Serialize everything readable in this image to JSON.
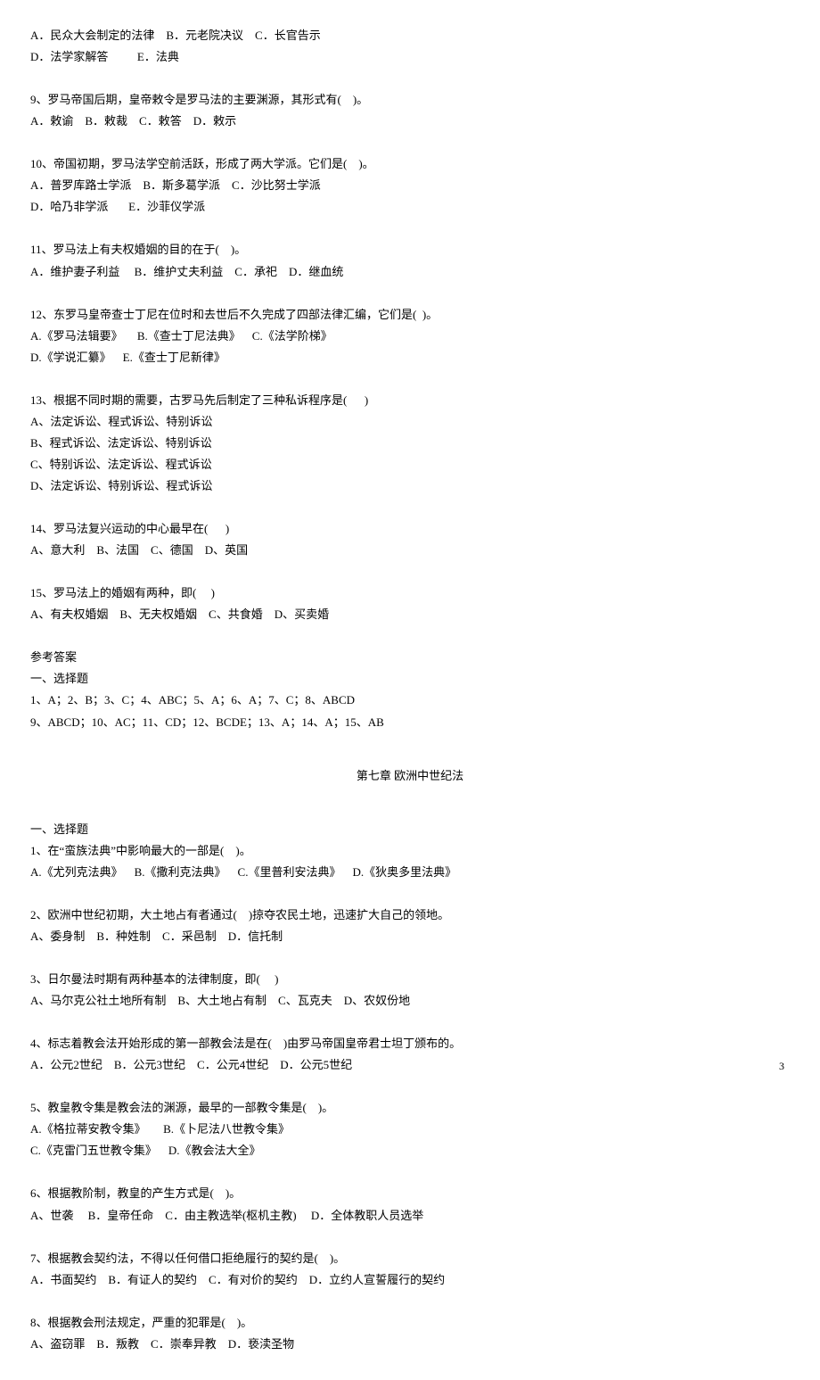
{
  "q8_opts1": "A．民众大会制定的法律    B．元老院决议    C．长官告示",
  "q8_opts2": "D．法学家解答          E．法典",
  "q9_stem": "9、罗马帝国后期，皇帝敕令是罗马法的主要渊源，其形式有(    )。",
  "q9_opts": "A．敕谕    B．敕裁    C．敕答    D．敕示",
  "q10_stem": "10、帝国初期，罗马法学空前活跃，形成了两大学派。它们是(    )。",
  "q10_opts1": "A．普罗库路士学派    B．斯多葛学派    C．沙比努士学派",
  "q10_opts2": "D．哈乃非学派       E．沙菲仪学派",
  "q11_stem": "11、罗马法上有夫权婚姻的目的在于(    )。",
  "q11_opts": "A．维护妻子利益     B．维护丈夫利益    C．承祀    D．继血统",
  "q12_stem": "12、东罗马皇帝查士丁尼在位时和去世后不久完成了四部法律汇编，它们是(  )。",
  "q12_opts1": "A.《罗马法辑要》     B.《查士丁尼法典》    C.《法学阶梯》",
  "q12_opts2": "D.《学说汇纂》    E.《查士丁尼新律》",
  "q13_stem": "13、根据不同时期的需要，古罗马先后制定了三种私诉程序是(      )",
  "q13_a": "A、法定诉讼、程式诉讼、特别诉讼",
  "q13_b": "B、程式诉讼、法定诉讼、特别诉讼",
  "q13_c": "C、特别诉讼、法定诉讼、程式诉讼",
  "q13_d": "D、法定诉讼、特别诉讼、程式诉讼",
  "q14_stem": "14、罗马法复兴运动的中心最早在(      )",
  "q14_opts": "A、意大利    B、法国    C、德国    D、英国",
  "q15_stem": "15、罗马法上的婚姻有两种，即(     )",
  "q15_opts": "A、有夫权婚姻    B、无夫权婚姻    C、共食婚    D、买卖婚",
  "ans_title": "参考答案",
  "ans_sec": "一、选择题",
  "ans_l1": "1、A；2、B；3、C；4、ABC；5、A；6、A；7、C；8、ABCD",
  "ans_l2": "9、ABCD；10、AC；11、CD；12、BCDE；13、A；14、A；15、AB",
  "chapter": "第七章    欧洲中世纪法",
  "sec1": "一、选择题",
  "c1_stem": "1、在“蛮族法典”中影响最大的一部是(    )。",
  "c1_opts": "A.《尤列克法典》    B.《撒利克法典》    C.《里普利安法典》    D.《狄奥多里法典》",
  "c2_stem": "2、欧洲中世纪初期，大土地占有者通过(    )掠夺农民土地，迅速扩大自己的领地。",
  "c2_opts": "A、委身制    B．种姓制    C．采邑制    D．信托制",
  "c3_stem": "3、日尔曼法时期有两种基本的法律制度，即(     )",
  "c3_opts": "A、马尔克公社土地所有制    B、大土地占有制    C、瓦克夫    D、农奴份地",
  "c4_stem": "4、标志着教会法开始形成的第一部教会法是在(    )由罗马帝国皇帝君士坦丁颁布的。",
  "c4_opts": "A．公元2世纪    B．公元3世纪    C．公元4世纪    D．公元5世纪",
  "c5_stem": "5、教皇教令集是教会法的渊源，最早的一部教令集是(    )。",
  "c5_opts1": "A.《格拉蒂安教令集》      B.《卜尼法八世教令集》",
  "c5_opts2": "C.《克雷门五世教令集》    D.《教会法大全》",
  "c6_stem": "6、根据教阶制，教皇的产生方式是(    )。",
  "c6_opts": "A、世袭     B．皇帝任命    C．由主教选举(枢机主教)     D．全体教职人员选举",
  "c7_stem": "7、根据教会契约法，不得以任何借口拒绝履行的契约是(    )。",
  "c7_opts": "A．书面契约    B．有证人的契约    C．有对价的契约    D．立约人宣誓履行的契约",
  "c8_stem": "8、根据教会刑法规定，严重的犯罪是(    )。",
  "c8_opts": "A、盗窃罪    B．叛教    C．崇奉异教    D．亵渎圣物",
  "page": "3"
}
